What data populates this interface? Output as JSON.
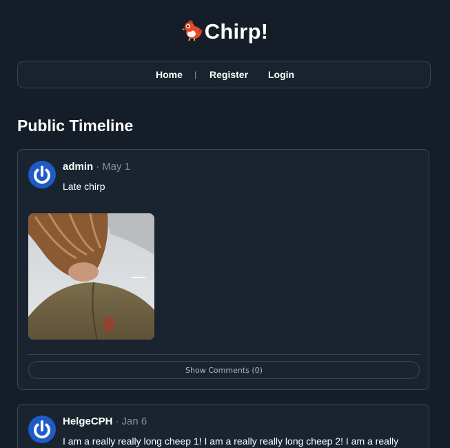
{
  "brand": {
    "title": "Chirp!",
    "logo_icon": "bird-icon"
  },
  "nav": {
    "items": [
      {
        "label": "Home"
      },
      {
        "label": "Register"
      },
      {
        "label": "Login"
      }
    ],
    "separator": "|"
  },
  "page_title": "Public Timeline",
  "cheeps": [
    {
      "author": "admin",
      "separator": "·",
      "date": "May 1",
      "text": "Late chirp",
      "has_image": true,
      "comments_label": "Show Comments (0)",
      "avatar_icon": "power-avatar-icon"
    },
    {
      "author": "HelgeCPH",
      "separator": "·",
      "date": "Jan 6",
      "text": "I am a really really long cheep 1! I am a really really long cheep 2! I am a really",
      "avatar_icon": "power-avatar-icon"
    }
  ],
  "colors": {
    "background": "#151e28",
    "card": "#1a2431",
    "border": "#394656",
    "muted": "#8591a1",
    "avatar_blue": "#1f5bc7"
  }
}
